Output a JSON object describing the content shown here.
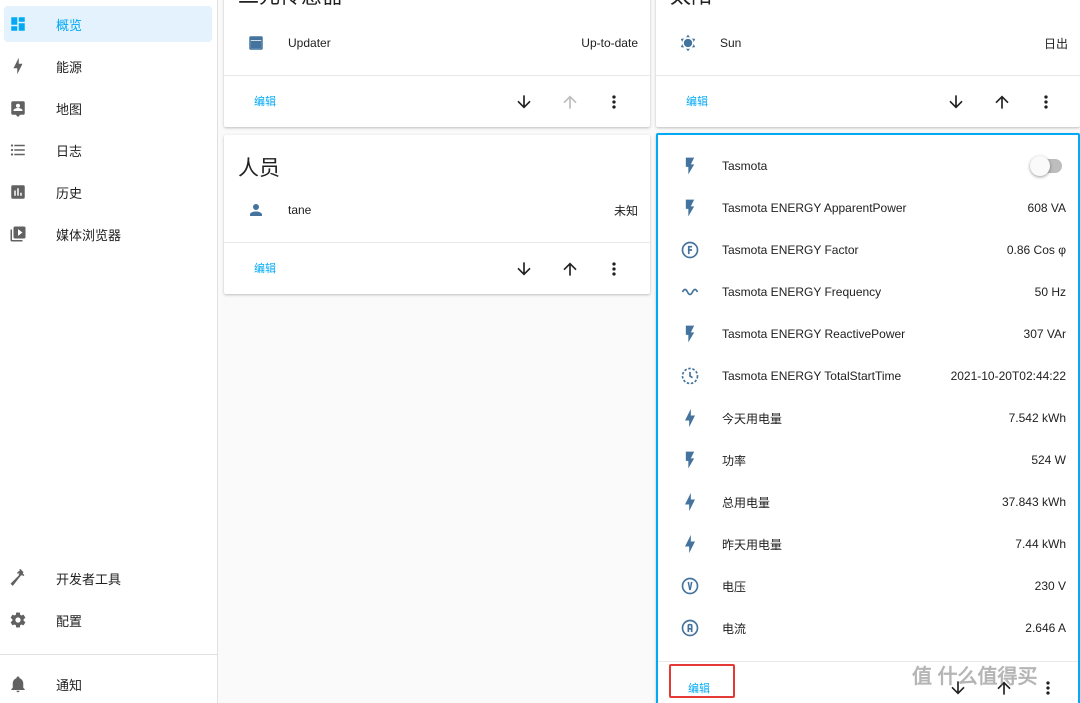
{
  "colors": {
    "accent": "#03a9f4",
    "icon": "#44739e",
    "sidebar_icon": "#616161",
    "highlight": "#e53935"
  },
  "sidebar": {
    "items": [
      {
        "label": "概览",
        "icon": "dashboard-icon",
        "active": true
      },
      {
        "label": "能源",
        "icon": "lightning-icon"
      },
      {
        "label": "地图",
        "icon": "map-account-icon"
      },
      {
        "label": "日志",
        "icon": "list-icon"
      },
      {
        "label": "历史",
        "icon": "chart-bar-icon"
      },
      {
        "label": "媒体浏览器",
        "icon": "play-box-icon"
      }
    ],
    "bottom_items": [
      {
        "label": "开发者工具",
        "icon": "hammer-icon"
      },
      {
        "label": "配置",
        "icon": "gear-icon"
      }
    ],
    "notifications": {
      "label": "通知",
      "icon": "bell-icon"
    }
  },
  "cards": {
    "binary_sensor": {
      "title": "二元传感器",
      "rows": [
        {
          "name": "Updater",
          "value": "Up-to-date",
          "icon": "package-icon"
        }
      ],
      "edit_label": "编辑"
    },
    "sun": {
      "title": "太阳",
      "rows": [
        {
          "name": "Sun",
          "value": "日出",
          "icon": "sun-icon"
        }
      ],
      "edit_label": "编辑"
    },
    "person": {
      "title": "人员",
      "rows": [
        {
          "name": "tane",
          "value": "未知",
          "icon": "account-icon"
        }
      ],
      "edit_label": "编辑"
    },
    "tasmota": {
      "rows": [
        {
          "name": "Tasmota",
          "value": "",
          "icon": "flash-icon",
          "toggle": true
        },
        {
          "name": "Tasmota ENERGY ApparentPower",
          "value": "608 VA",
          "icon": "flash-icon"
        },
        {
          "name": "Tasmota ENERGY Factor",
          "value": "0.86 Cos φ",
          "icon": "alpha-f-circle-icon"
        },
        {
          "name": "Tasmota ENERGY Frequency",
          "value": "50 Hz",
          "icon": "sine-wave-icon"
        },
        {
          "name": "Tasmota ENERGY ReactivePower",
          "value": "307 VAr",
          "icon": "flash-icon"
        },
        {
          "name": "Tasmota ENERGY TotalStartTime",
          "value": "2021-10-20T02:44:22",
          "icon": "clock-outline-icon"
        },
        {
          "name": "今天用电量",
          "value": "7.542 kWh",
          "icon": "lightning-icon"
        },
        {
          "name": "功率",
          "value": "524 W",
          "icon": "flash-icon"
        },
        {
          "name": "总用电量",
          "value": "37.843 kWh",
          "icon": "lightning-icon"
        },
        {
          "name": "昨天用电量",
          "value": "7.44 kWh",
          "icon": "lightning-icon"
        },
        {
          "name": "电压",
          "value": "230 V",
          "icon": "alpha-v-circle-icon"
        },
        {
          "name": "电流",
          "value": "2.646 A",
          "icon": "alpha-a-circle-icon"
        }
      ],
      "edit_label": "编辑"
    }
  },
  "watermark": "值 什么值得买"
}
